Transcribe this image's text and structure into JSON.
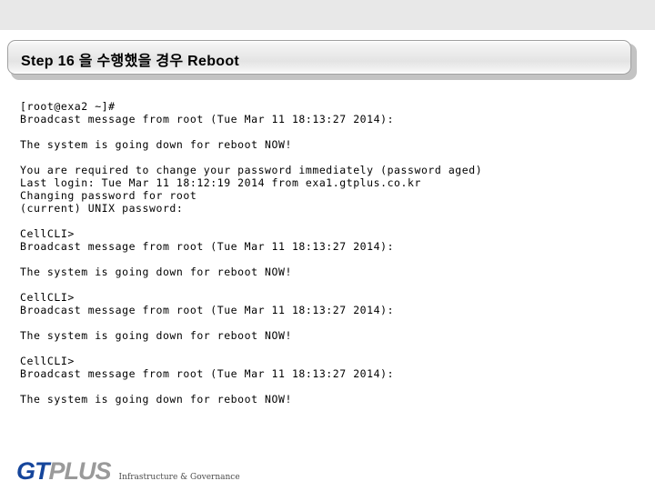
{
  "slide": {
    "title": "Step 16 을 수행했을 경우 Reboot"
  },
  "terminal": {
    "lines": [
      "[root@exa2 ~]#",
      "Broadcast message from root (Tue Mar 11 18:13:27 2014):",
      "",
      "The system is going down for reboot NOW!",
      "",
      "You are required to change your password immediately (password aged)",
      "Last login: Tue Mar 11 18:12:19 2014 from exa1.gtplus.co.kr",
      "Changing password for root",
      "(current) UNIX password:",
      "",
      "CellCLI>",
      "Broadcast message from root (Tue Mar 11 18:13:27 2014):",
      "",
      "The system is going down for reboot NOW!",
      "",
      "CellCLI>",
      "Broadcast message from root (Tue Mar 11 18:13:27 2014):",
      "",
      "The system is going down for reboot NOW!",
      "",
      "CellCLI>",
      "Broadcast message from root (Tue Mar 11 18:13:27 2014):",
      "",
      "The system is going down for reboot NOW!"
    ]
  },
  "footer": {
    "logo_primary": "GT",
    "logo_secondary": "PLUS",
    "tagline": "Infrastructure & Governance"
  },
  "colors": {
    "top_band": "#e8e8e8",
    "logo_primary": "#15459b",
    "logo_secondary": "#9a9a9a",
    "title_border": "#a0a0a0"
  }
}
